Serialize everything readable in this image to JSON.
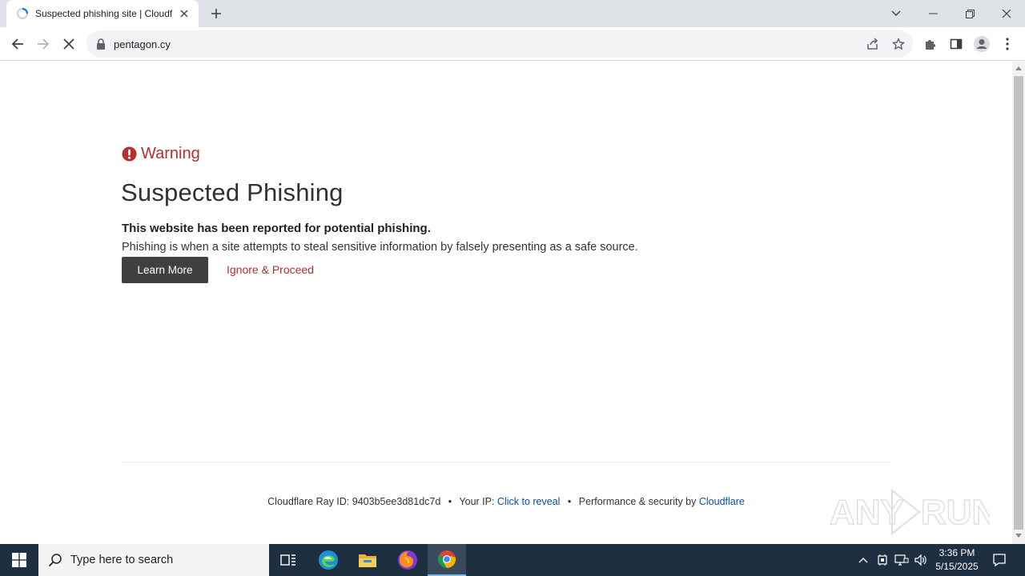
{
  "browser": {
    "tab_title": "Suspected phishing site | Cloudflare",
    "url": "pentagon.cy"
  },
  "page": {
    "warning_label": "Warning",
    "title": "Suspected Phishing",
    "subtitle": "This website has been reported for potential phishing.",
    "description": "Phishing is when a site attempts to steal sensitive information by falsely presenting as a safe source.",
    "learn_more": "Learn More",
    "ignore_proceed": "Ignore & Proceed",
    "footer": {
      "ray_label": "Cloudflare Ray ID:",
      "ray_id": "9403b5ee3d81dc7d",
      "ip_label": "Your IP:",
      "ip_link": "Click to reveal",
      "perf_label": "Performance & security by",
      "cloudflare_link": "Cloudflare"
    },
    "colors": {
      "warning": "#b2302d",
      "link": "#0b4ea2"
    }
  },
  "taskbar": {
    "search_placeholder": "Type here to search",
    "time": "3:36 PM",
    "date": "5/15/2025"
  }
}
